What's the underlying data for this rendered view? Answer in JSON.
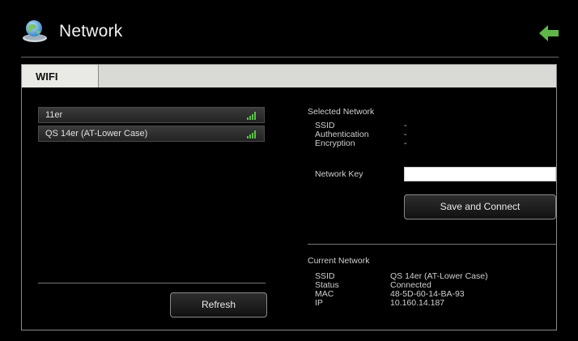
{
  "header": {
    "title": "Network",
    "app_icon": "network-globe-icon",
    "back_icon": "back-arrow-icon",
    "accent": "#5fb548"
  },
  "tabs": [
    {
      "label": "WIFI",
      "active": true
    }
  ],
  "networks": [
    {
      "ssid": "11er",
      "signal_icon": "signal-strength-icon"
    },
    {
      "ssid": "QS 14er (AT-Lower Case)",
      "signal_icon": "signal-strength-icon"
    }
  ],
  "refresh_label": "Refresh",
  "selected": {
    "title": "Selected Network",
    "ssid_label": "SSID",
    "ssid_value": "-",
    "auth_label": "Authentication",
    "auth_value": "-",
    "enc_label": "Encryption",
    "enc_value": "-",
    "key_label": "Network Key",
    "key_value": "",
    "save_label": "Save and Connect"
  },
  "current": {
    "title": "Current Network",
    "ssid_label": "SSID",
    "ssid_value": "QS 14er (AT-Lower Case)",
    "status_label": "Status",
    "status_value": "Connected",
    "mac_label": "MAC",
    "mac_value": "48-5D-60-14-BA-93",
    "ip_label": "IP",
    "ip_value": "10.160.14.187"
  }
}
